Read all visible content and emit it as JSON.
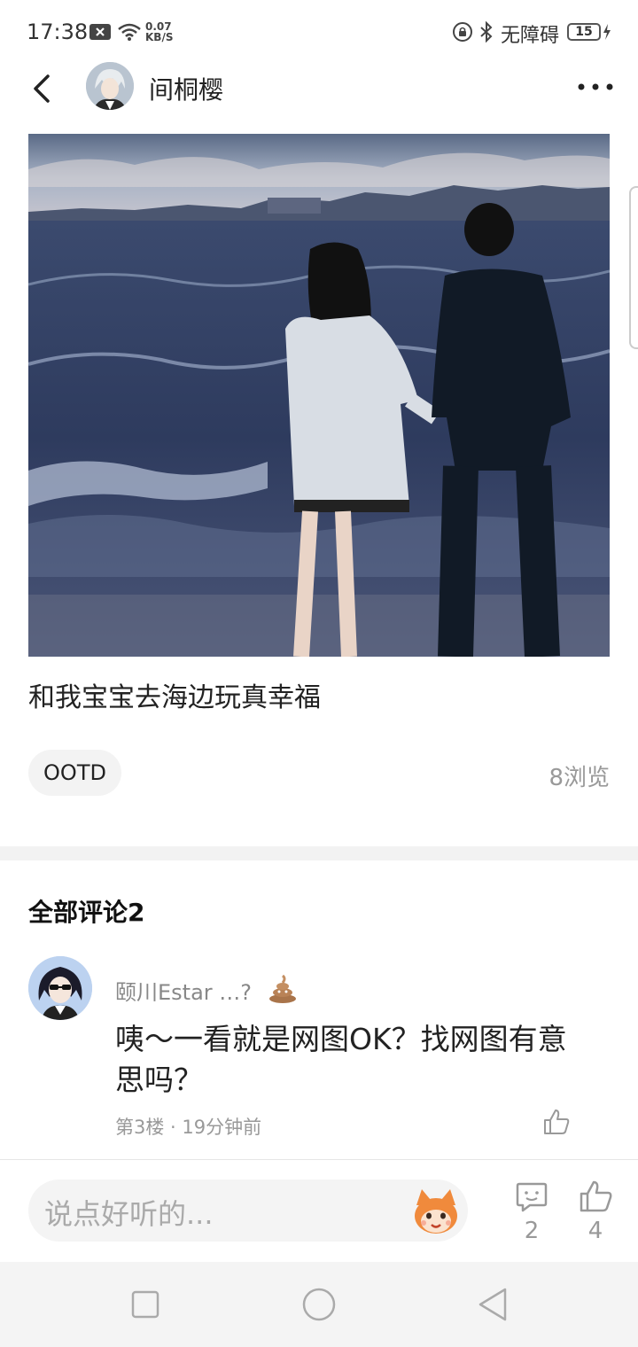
{
  "status_bar": {
    "time": "17:38",
    "net_speed_value": "0.07",
    "net_speed_unit": "KB/S",
    "accessibility": "无障碍",
    "battery": "15"
  },
  "header": {
    "author_name": "间桐樱"
  },
  "post": {
    "text": "和我宝宝去海边玩真幸福",
    "tag": "OOTD",
    "views": "8浏览"
  },
  "comments": {
    "title": "全部评论2",
    "items": [
      {
        "user": "颐川Estar …?",
        "body": "咦～一看就是网图OK？找网图有意思吗？",
        "meta": "第3楼 · 19分钟前"
      }
    ]
  },
  "bottom_bar": {
    "input_placeholder": "说点好听的...",
    "reply_count": "2",
    "like_count": "4"
  },
  "colors": {
    "accent_orange": "#f08a3c",
    "muted_text": "#999999",
    "divider": "#f2f2f2"
  }
}
